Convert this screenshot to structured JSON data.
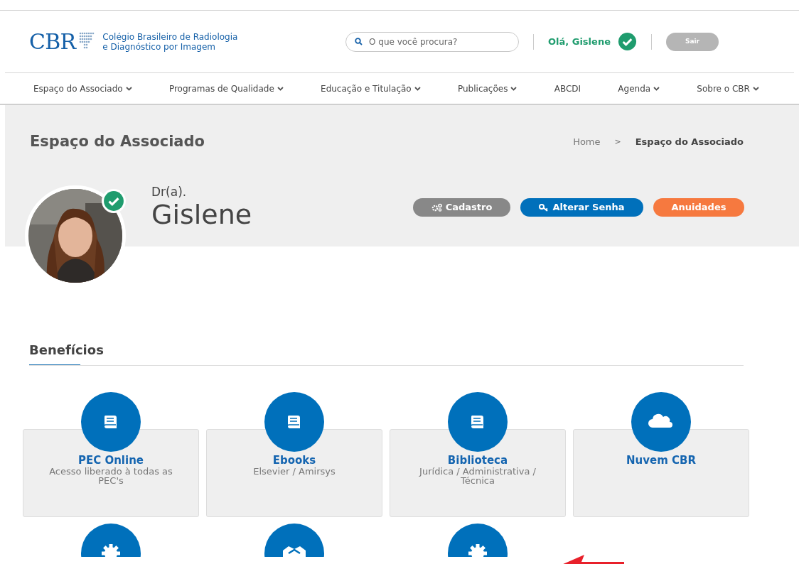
{
  "header": {
    "logo": "CBR",
    "org_name": [
      "Colégio Brasileiro de Radiologia",
      "e Diagnóstico por Imagem"
    ],
    "search": {
      "placeholder": "O que você procura?"
    },
    "greeting": "Olá, Gislene",
    "verified": true,
    "logout": "Sair"
  },
  "nav": [
    {
      "label": "Espaço do Associado",
      "dropdown": true
    },
    {
      "label": "Programas de Qualidade",
      "dropdown": true
    },
    {
      "label": "Educação e Titulação",
      "dropdown": true
    },
    {
      "label": "Publicações",
      "dropdown": true
    },
    {
      "label": "ABCDI",
      "dropdown": false
    },
    {
      "label": "Agenda",
      "dropdown": true
    },
    {
      "label": "Sobre o CBR",
      "dropdown": true
    }
  ],
  "page_title": "Espaço do Associado",
  "breadcrumb": [
    {
      "label": "Home",
      "current": false
    },
    {
      "label": "Espaço do Associado",
      "current": true
    }
  ],
  "breadcrumb_separator": ">",
  "profile": {
    "verified": true,
    "prefix": "Dr(a).",
    "name": "Gislene"
  },
  "actions": [
    {
      "label": "Cadastro",
      "kind": "gears",
      "color": "#888888"
    },
    {
      "label": "Alterar Senha",
      "kind": "key",
      "color": "#0070bb"
    },
    {
      "label": "Anuidades",
      "kind": "plain",
      "color": "#f6793f"
    }
  ],
  "benefits_title": "Benefícios",
  "benefits": [
    {
      "kind": "book",
      "title": "PEC Online",
      "subtitle": "Acesso liberado à todas as PEC's"
    },
    {
      "kind": "book",
      "title": "Ebooks",
      "subtitle": "Elsevier / Amirsys"
    },
    {
      "kind": "book",
      "title": "Biblioteca",
      "subtitle": "Jurídica / Administrativa / Técnica"
    },
    {
      "kind": "cloud",
      "title": "Nuvem CBR"
    },
    {
      "kind": "gear"
    },
    {
      "kind": "handshake"
    },
    {
      "kind": "gear"
    }
  ]
}
